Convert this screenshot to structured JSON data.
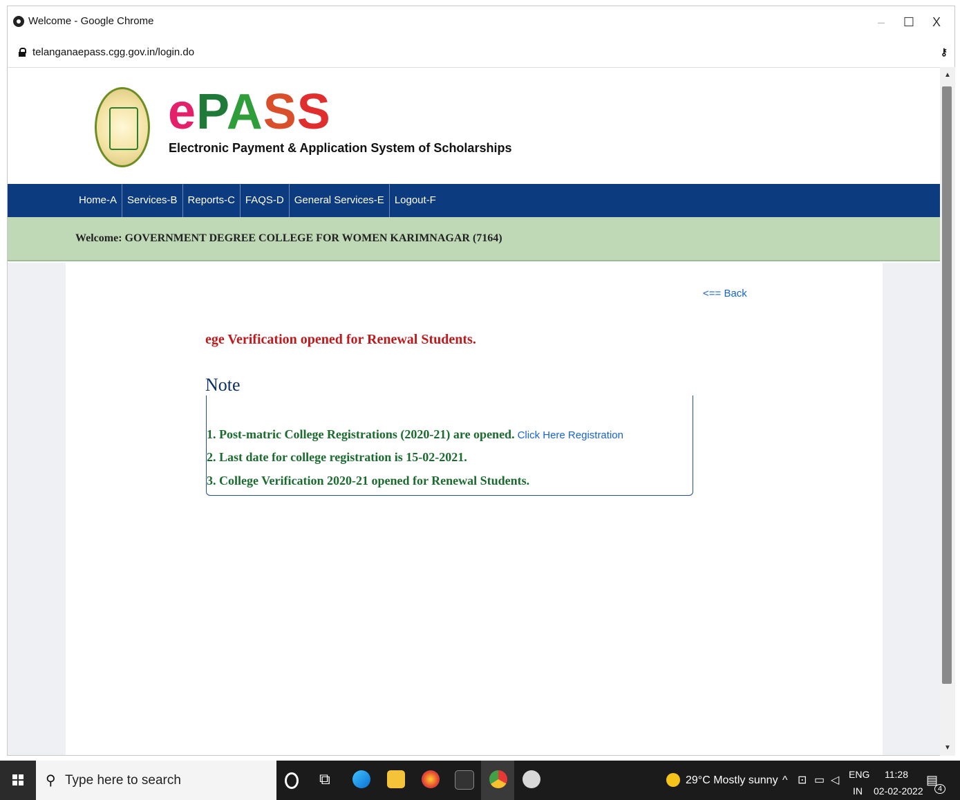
{
  "window": {
    "title": "Welcome - Google Chrome",
    "minimize": "‒",
    "maximize": "☐",
    "close": "X"
  },
  "address_bar": {
    "url": "telanganaepass.cgg.gov.in/login.do",
    "key_icon": "key-icon"
  },
  "header": {
    "brand": {
      "e": "e",
      "p": "P",
      "a": "A",
      "s1": "S",
      "s2": "S"
    },
    "tagline": "Electronic Payment & Application System of Scholarships"
  },
  "nav": {
    "items": [
      {
        "label": "Home-A"
      },
      {
        "label": "Services-B"
      },
      {
        "label": "Reports-C"
      },
      {
        "label": "FAQS-D"
      },
      {
        "label": "General Services-E"
      },
      {
        "label": "Logout-F"
      }
    ]
  },
  "welcome": {
    "text": "Welcome: GOVERNMENT DEGREE COLLEGE FOR WOMEN KARIMNAGAR (7164)"
  },
  "content": {
    "back_link": "<== Back",
    "marquee": "ege Verification opened for Renewal Students.",
    "note": {
      "title": "Note",
      "lines": [
        {
          "text": "1. Post-matric College Registrations (2020-21) are opened.",
          "link": "Click Here Registration"
        },
        {
          "text": "2. Last date for college registration is 15-02-2021."
        },
        {
          "text": "3. College Verification 2020-21 opened for Renewal Students."
        }
      ]
    }
  },
  "taskbar": {
    "search_placeholder": "Type here to search",
    "weather": "29°C  Mostly sunny",
    "lang_top": "ENG",
    "lang_bottom": "IN",
    "time": "11:28",
    "date": "02-02-2022",
    "notification_count": "4"
  },
  "colors": {
    "nav_bg": "#0c3b80",
    "welcome_bg": "#bfd9b6",
    "marquee": "#c0191c",
    "note_text": "#1b6b2e",
    "link": "#1763d6"
  }
}
